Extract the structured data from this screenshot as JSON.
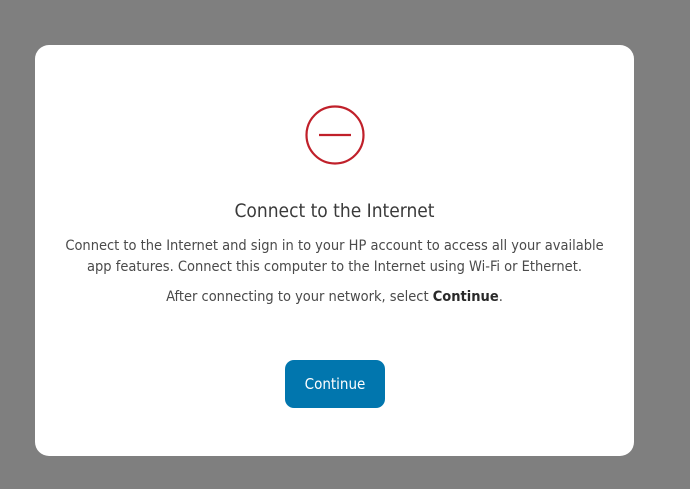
{
  "dialog": {
    "icon": "no-connection-icon",
    "icon_color": "#c0202a",
    "title": "Connect to the Internet",
    "body": "Connect to the Internet and sign in to your HP account to access all your available app features. Connect this computer to the Internet using Wi-Fi or Ethernet.",
    "after_prefix": "After connecting to your network, select ",
    "after_emphasis": "Continue",
    "after_suffix": ".",
    "continue_label": "Continue",
    "button_color": "#0176ae"
  },
  "backdrop_color": "#7f7f7f"
}
